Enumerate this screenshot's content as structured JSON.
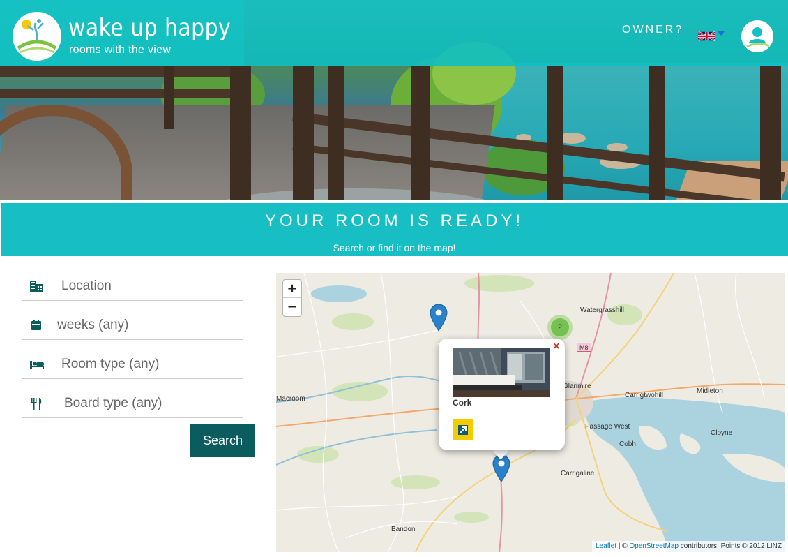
{
  "header": {
    "brand_title": "wake up happy",
    "brand_subtitle": "rooms with the view",
    "owner_link": "OWNER?",
    "language": "en-GB"
  },
  "banner": {
    "title": "YOUR ROOM IS READY!",
    "subtitle": "Search or find it on the map!"
  },
  "search": {
    "location_placeholder": "Location",
    "weeks_placeholder": "weeks (any)",
    "room_type_placeholder": "Room type (any)",
    "board_type_placeholder": "Board type (any)",
    "submit_label": "Search",
    "icons": [
      "building-icon",
      "calendar-icon",
      "bed-icon",
      "cutlery-icon"
    ]
  },
  "map": {
    "zoom_in": "+",
    "zoom_out": "−",
    "labels": [
      "Watergrasshill",
      "Glanmire",
      "Carrigtwohill",
      "Midleton",
      "Macroom",
      "Passage West",
      "Cobh",
      "Cloyne",
      "Carrigaline",
      "Bandon"
    ],
    "road_badge": "M8",
    "cluster_count": "2",
    "popup": {
      "title": "Cork",
      "close": "×"
    },
    "attribution": {
      "leaflet": "Leaflet",
      "sep": " | © ",
      "osm": "OpenStreetMap",
      "rest": " contributors, Points © 2012 LINZ"
    }
  },
  "colors": {
    "accent": "#17bec3",
    "header_bar": "#0dbec4",
    "button": "#0b5c5e",
    "icon": "#0b5c5e",
    "marker": "#2a81cb",
    "popup_link": "#f3cd00"
  }
}
